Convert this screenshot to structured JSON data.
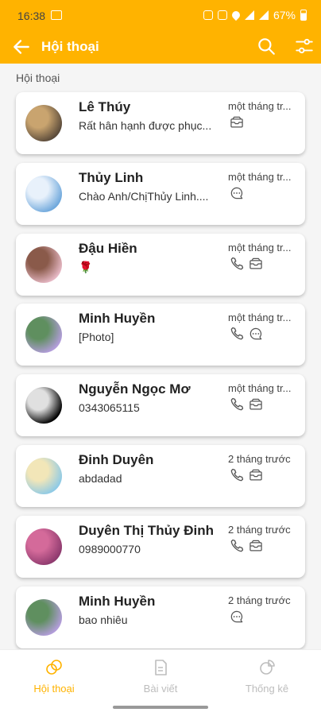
{
  "status_bar": {
    "time": "16:38",
    "battery": "67%"
  },
  "app_bar": {
    "title": "Hội thoại"
  },
  "section_label": "Hội thoại",
  "conversations": [
    {
      "name": "Lê Thúy",
      "message": "Rất hân hạnh được phục...",
      "time": "một tháng tr...",
      "channels": [
        "mail"
      ],
      "avatar_colors": [
        "#5a4a3a",
        "#c9a46f"
      ]
    },
    {
      "name": "Thủy Linh",
      "message": "Chào Anh/ChịThủy Linh....",
      "time": "một tháng tr...",
      "channels": [
        "chat"
      ],
      "avatar_colors": [
        "#6fa8dc",
        "#e8f1fb"
      ]
    },
    {
      "name": "Đậu Hiền",
      "message": "🌹",
      "time": "một tháng tr...",
      "channels": [
        "phone",
        "mail"
      ],
      "avatar_colors": [
        "#e6b8c4",
        "#8a5a4a"
      ]
    },
    {
      "name": "Minh Huyền",
      "message": "[Photo]",
      "time": "một tháng tr...",
      "channels": [
        "phone",
        "chat"
      ],
      "avatar_colors": [
        "#b39ddb",
        "#5f8f5f"
      ]
    },
    {
      "name": "Nguyễn Ngọc Mơ",
      "message": "0343065115",
      "time": "một tháng tr...",
      "channels": [
        "phone",
        "mail"
      ],
      "avatar_colors": [
        "#000000",
        "#e0e0e0"
      ]
    },
    {
      "name": "Đinh Duyên",
      "message": "abdadad",
      "time": "2 tháng trước",
      "channels": [
        "phone",
        "mail"
      ],
      "avatar_colors": [
        "#8ecae6",
        "#f2e6b8"
      ]
    },
    {
      "name": "Duyên Thị Thủy Đinh",
      "message": "0989000770",
      "time": "2 tháng trước",
      "channels": [
        "phone",
        "mail"
      ],
      "avatar_colors": [
        "#8e3a6e",
        "#d46a9a"
      ]
    },
    {
      "name": "Minh Huyền",
      "message": "bao nhiêu",
      "time": "2 tháng trước",
      "channels": [
        "chat"
      ],
      "avatar_colors": [
        "#b39ddb",
        "#5f8f5f"
      ]
    }
  ],
  "bottom_nav": [
    {
      "label": "Hội thoại",
      "icon": "chat-bubbles-icon",
      "active": true
    },
    {
      "label": "Bài viết",
      "icon": "document-icon",
      "active": false
    },
    {
      "label": "Thống kê",
      "icon": "pie-chart-icon",
      "active": false
    }
  ],
  "colors": {
    "accent": "#ffb300",
    "inactive": "#bdbdbd"
  }
}
